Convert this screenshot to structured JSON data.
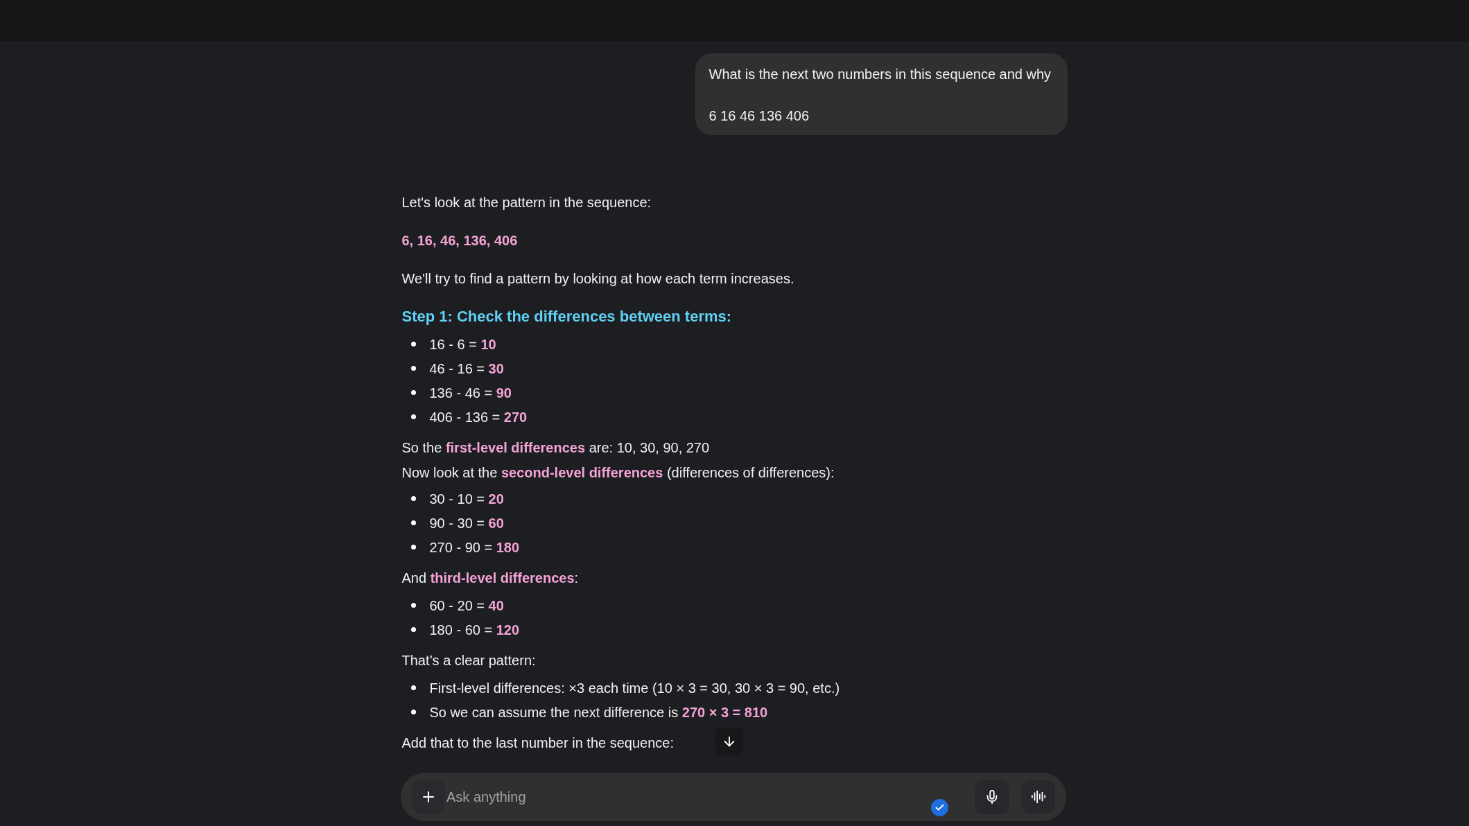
{
  "user_message": {
    "lines": [
      "What is the next two numbers in this sequence and why",
      "6 16 46 136 406"
    ]
  },
  "response": [
    {
      "kind": "paragraph",
      "text": "Let's look at the pattern in the sequence:"
    },
    {
      "kind": "paragraph",
      "text": "**6, 16, 46, 136, 406**"
    },
    {
      "kind": "paragraph",
      "text": "We'll try to find a pattern by looking at how each term increases."
    },
    {
      "kind": "heading",
      "text": "Step 1: Check the differences between terms:"
    },
    {
      "kind": "bullets",
      "items": [
        "16 - 6 = **10**",
        "46 - 16 = **30**",
        "136 - 46 = **90**",
        "406 - 136 = **270**"
      ]
    },
    {
      "kind": "lines",
      "items": [
        "So the **first-level differences** are: 10, 30, 90, 270",
        "Now look at the **second-level differences** (differences of differences):"
      ]
    },
    {
      "kind": "bullets",
      "items": [
        "30 - 10 = **20**",
        "90 - 30 = **60**",
        "270 - 90 = **180**"
      ]
    },
    {
      "kind": "paragraph",
      "text": "And **third-level differences**:"
    },
    {
      "kind": "bullets",
      "items": [
        "60 - 20 = **40**",
        "180 - 60 = **120**"
      ]
    },
    {
      "kind": "paragraph",
      "text": "That’s a clear pattern:"
    },
    {
      "kind": "bullets",
      "items": [
        "First-level differences: ×3 each time (10 × 3 = 30, 30 × 3 = 90, etc.)",
        "So we can assume the next difference is **270 × 3 = 810**"
      ]
    },
    {
      "kind": "paragraph",
      "text": "Add that to the last number in the sequence:"
    }
  ],
  "composer": {
    "placeholder": "Ask anything"
  }
}
